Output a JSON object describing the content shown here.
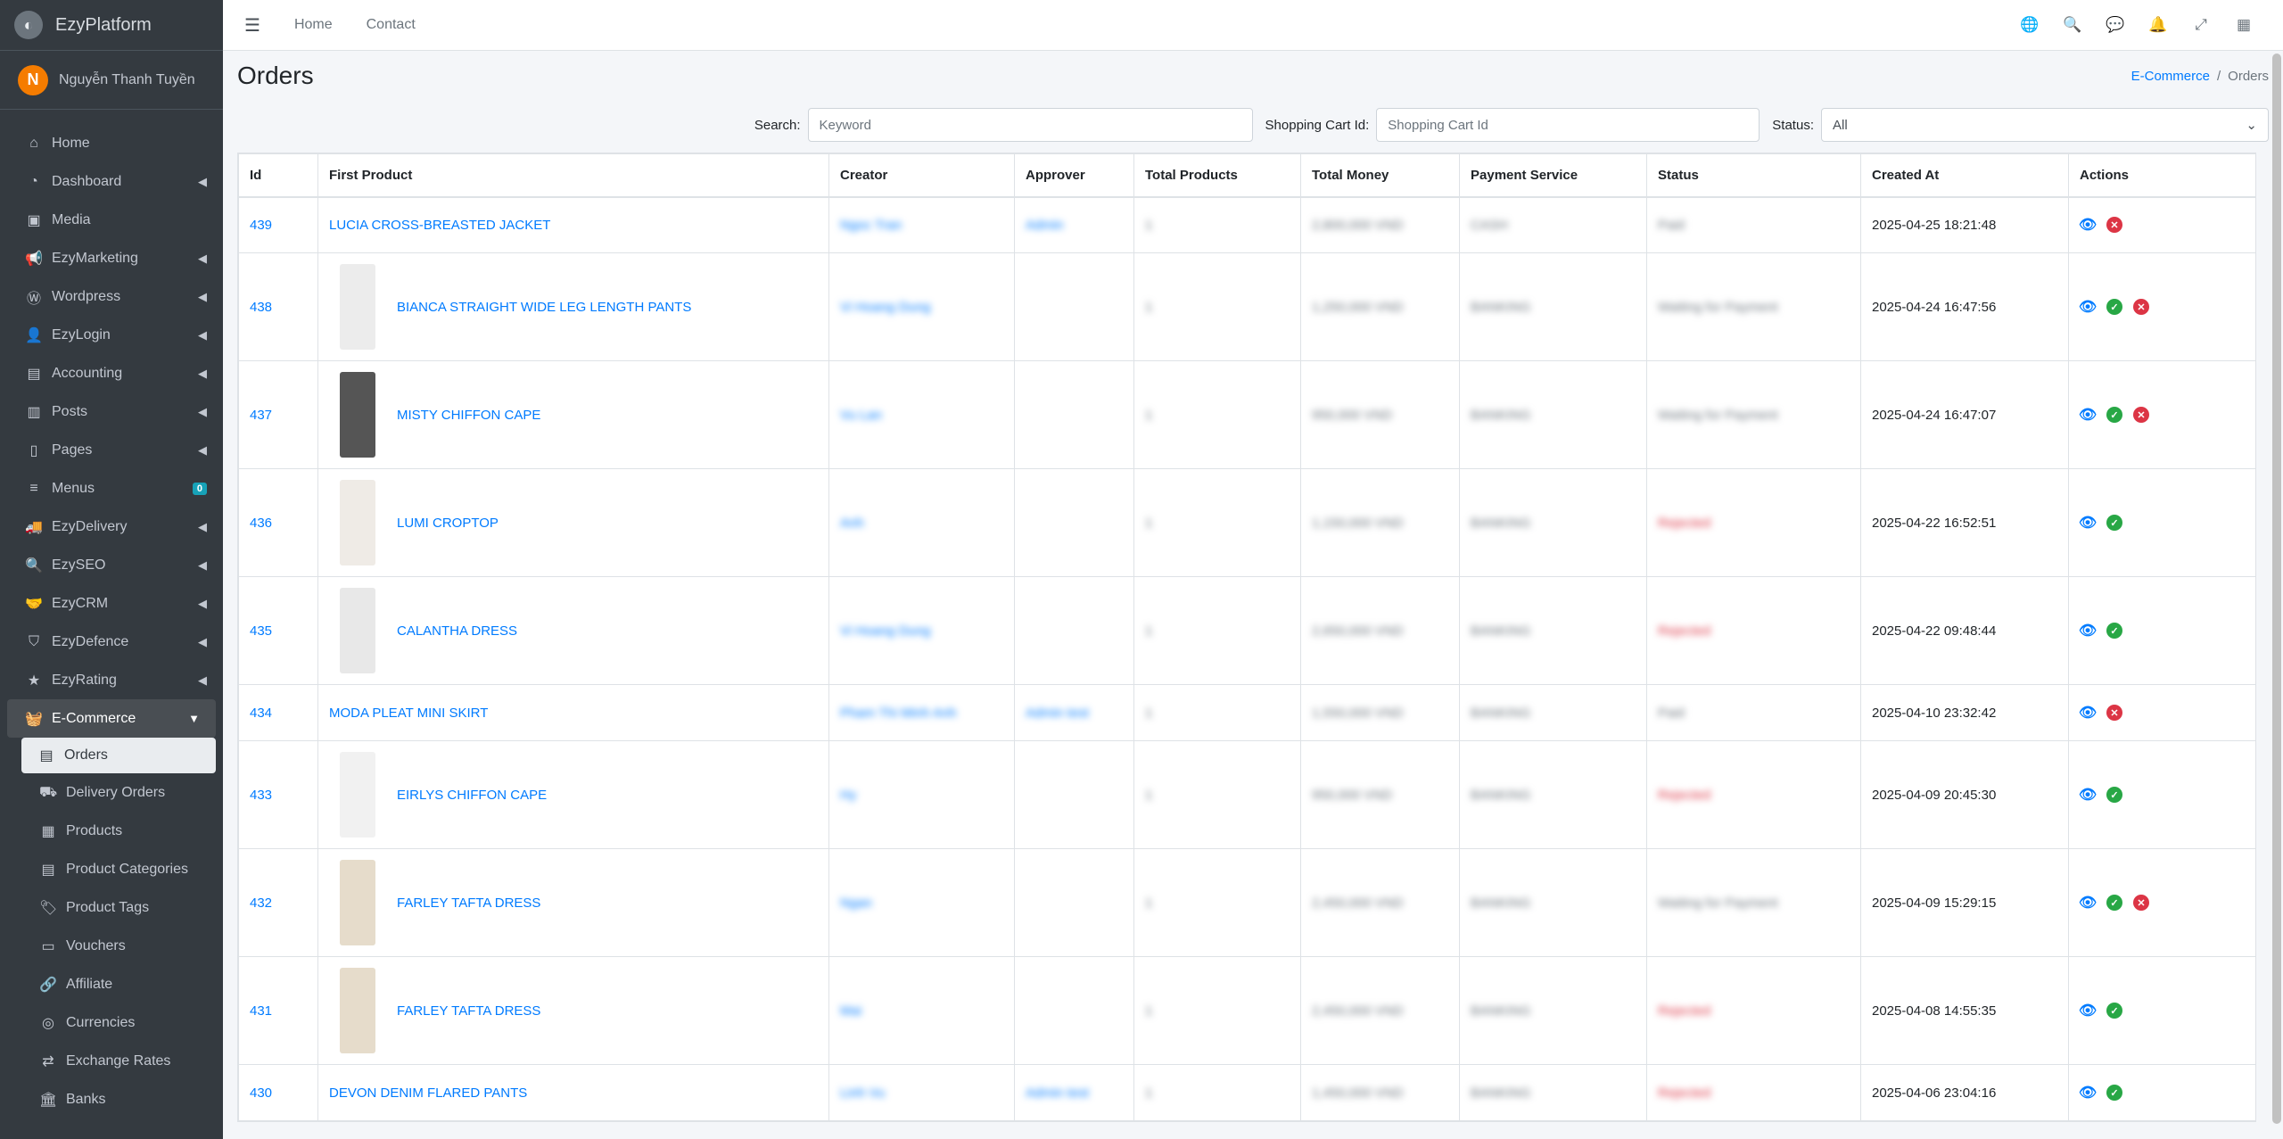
{
  "brand": {
    "name": "EzyPlatform",
    "logo_icon": "platform-logo-icon"
  },
  "user": {
    "initial": "N",
    "name": "Nguyễn Thanh Tuyền"
  },
  "sidebar": {
    "items": [
      {
        "label": "Home",
        "icon": "home-icon"
      },
      {
        "label": "Dashboard",
        "icon": "dashboard-icon"
      },
      {
        "label": "Media",
        "icon": "media-icon"
      },
      {
        "label": "EzyMarketing",
        "icon": "bullhorn-icon"
      },
      {
        "label": "Wordpress",
        "icon": "wordpress-icon"
      },
      {
        "label": "EzyLogin",
        "icon": "user-lock-icon"
      },
      {
        "label": "Accounting",
        "icon": "accounting-icon"
      },
      {
        "label": "Posts",
        "icon": "posts-icon"
      },
      {
        "label": "Pages",
        "icon": "pages-icon"
      },
      {
        "label": "Menus",
        "icon": "menu-icon",
        "badge": "0"
      },
      {
        "label": "EzyDelivery",
        "icon": "truck-icon"
      },
      {
        "label": "EzySEO",
        "icon": "seo-icon"
      },
      {
        "label": "EzyCRM",
        "icon": "handshake-icon"
      },
      {
        "label": "EzyDefence",
        "icon": "shield-icon"
      },
      {
        "label": "EzyRating",
        "icon": "star-icon"
      },
      {
        "label": "E-Commerce",
        "icon": "basket-icon"
      }
    ],
    "sub_items": [
      {
        "label": "Orders",
        "icon": "orders-icon"
      },
      {
        "label": "Delivery Orders",
        "icon": "delivery-orders-icon"
      },
      {
        "label": "Products",
        "icon": "products-icon"
      },
      {
        "label": "Product Categories",
        "icon": "categories-icon"
      },
      {
        "label": "Product Tags",
        "icon": "tags-icon"
      },
      {
        "label": "Vouchers",
        "icon": "voucher-icon"
      },
      {
        "label": "Affiliate",
        "icon": "link-icon"
      },
      {
        "label": "Currencies",
        "icon": "currency-icon"
      },
      {
        "label": "Exchange Rates",
        "icon": "exchange-icon"
      },
      {
        "label": "Banks",
        "icon": "bank-icon"
      }
    ]
  },
  "topbar": {
    "links": [
      "Home",
      "Contact"
    ],
    "icons": [
      "globe-icon",
      "search-icon",
      "comments-icon",
      "bell-icon",
      "expand-icon",
      "apps-icon"
    ]
  },
  "page": {
    "title": "Orders",
    "breadcrumb": {
      "parent": "E-Commerce",
      "sep": "/",
      "current": "Orders"
    }
  },
  "filters": {
    "search_label": "Search:",
    "search_placeholder": "Keyword",
    "cart_label": "Shopping Cart Id:",
    "cart_placeholder": "Shopping Cart Id",
    "status_label": "Status:",
    "status_value": "All"
  },
  "table": {
    "headers": [
      "Id",
      "First Product",
      "Creator",
      "Approver",
      "Total Products",
      "Total Money",
      "Payment Service",
      "Status",
      "Created At",
      "Actions"
    ],
    "rows": [
      {
        "id": "439",
        "product": "LUCIA CROSS-BREASTED JACKET",
        "thumb": false,
        "creator": "Ngoc Tran",
        "approver": "Admin",
        "total": "1",
        "money": "2,800,000 VND",
        "payment": "CASH",
        "status": "Paid",
        "status_color": "gray",
        "created": "2025-04-25 18:21:48",
        "actions": [
          "view",
          "cancel"
        ]
      },
      {
        "id": "438",
        "product": "BIANCA STRAIGHT WIDE LEG LENGTH PANTS",
        "thumb": "#ececec",
        "creator": "Vi Hoang Dung",
        "approver": "",
        "total": "1",
        "money": "1,250,000 VND",
        "payment": "BANKING",
        "status": "Waiting for Payment",
        "status_color": "gray",
        "created": "2025-04-24 16:47:56",
        "actions": [
          "view",
          "ok",
          "cancel"
        ]
      },
      {
        "id": "437",
        "product": "MISTY CHIFFON CAPE",
        "thumb": "#555555",
        "creator": "Vu Lan",
        "approver": "",
        "total": "1",
        "money": "950,000 VND",
        "payment": "BANKING",
        "status": "Waiting for Payment",
        "status_color": "gray",
        "created": "2025-04-24 16:47:07",
        "actions": [
          "view",
          "ok",
          "cancel"
        ]
      },
      {
        "id": "436",
        "product": "LUMI CROPTOP",
        "thumb": "#efebe6",
        "creator": "Anh",
        "approver": "",
        "total": "1",
        "money": "1,150,000 VND",
        "payment": "BANKING",
        "status": "Rejected",
        "status_color": "red",
        "created": "2025-04-22 16:52:51",
        "actions": [
          "view",
          "ok"
        ]
      },
      {
        "id": "435",
        "product": "CALANTHA DRESS",
        "thumb": "#e8e8e8",
        "creator": "Vi Hoang Dung",
        "approver": "",
        "total": "1",
        "money": "2,650,000 VND",
        "payment": "BANKING",
        "status": "Rejected",
        "status_color": "red",
        "created": "2025-04-22 09:48:44",
        "actions": [
          "view",
          "ok"
        ]
      },
      {
        "id": "434",
        "product": "MODA PLEAT MINI SKIRT",
        "thumb": false,
        "creator": "Pham Thi Minh Anh",
        "approver": "Admin test",
        "total": "1",
        "money": "1,550,000 VND",
        "payment": "BANKING",
        "status": "Paid",
        "status_color": "gray",
        "created": "2025-04-10 23:32:42",
        "actions": [
          "view",
          "cancel"
        ]
      },
      {
        "id": "433",
        "product": "EIRLYS CHIFFON CAPE",
        "thumb": "#f1f1f1",
        "creator": "Hy",
        "approver": "",
        "total": "1",
        "money": "950,000 VND",
        "payment": "BANKING",
        "status": "Rejected",
        "status_color": "red",
        "created": "2025-04-09 20:45:30",
        "actions": [
          "view",
          "ok"
        ]
      },
      {
        "id": "432",
        "product": "FARLEY TAFTA DRESS",
        "thumb": "#e6dccb",
        "creator": "Ngan",
        "approver": "",
        "total": "1",
        "money": "2,450,000 VND",
        "payment": "BANKING",
        "status": "Waiting for Payment",
        "status_color": "gray",
        "created": "2025-04-09 15:29:15",
        "actions": [
          "view",
          "ok",
          "cancel"
        ]
      },
      {
        "id": "431",
        "product": "FARLEY TAFTA DRESS",
        "thumb": "#e6dccb",
        "creator": "Mai",
        "approver": "",
        "total": "1",
        "money": "2,450,000 VND",
        "payment": "BANKING",
        "status": "Rejected",
        "status_color": "red",
        "created": "2025-04-08 14:55:35",
        "actions": [
          "view",
          "ok"
        ]
      },
      {
        "id": "430",
        "product": "DEVON DENIM FLARED PANTS",
        "thumb": false,
        "creator": "Linh Vu",
        "approver": "Admin test",
        "total": "1",
        "money": "1,450,000 VND",
        "payment": "BANKING",
        "status": "Rejected",
        "status_color": "red",
        "created": "2025-04-06 23:04:16",
        "actions": [
          "view",
          "ok"
        ]
      }
    ]
  }
}
